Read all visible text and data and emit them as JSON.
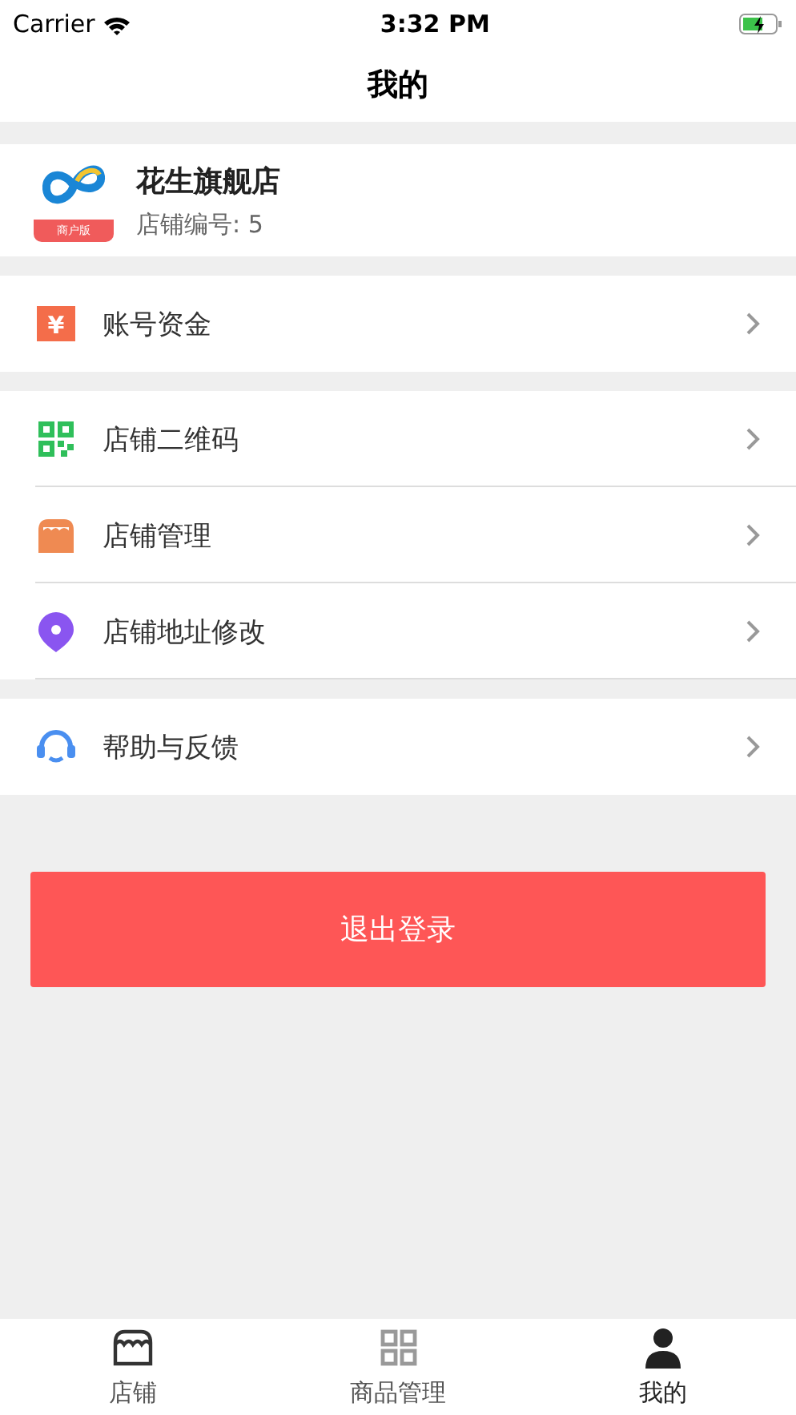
{
  "status_bar": {
    "carrier": "Carrier",
    "time": "3:32 PM"
  },
  "nav": {
    "title": "我的"
  },
  "shop": {
    "logo_badge": "商户版",
    "name": "花生旗舰店",
    "number": "店铺编号: 5"
  },
  "menu_groups": [
    {
      "items": [
        {
          "kind": "money",
          "label": "账号资金",
          "glyph": "¥"
        }
      ]
    },
    {
      "items": [
        {
          "kind": "qrcode",
          "label": "店铺二维码"
        },
        {
          "kind": "store",
          "label": "店铺管理"
        },
        {
          "kind": "location",
          "label": "店铺地址修改"
        }
      ]
    },
    {
      "items": [
        {
          "kind": "support",
          "label": "帮助与反馈"
        }
      ]
    }
  ],
  "logout_button": "退出登录",
  "tab_bar": [
    {
      "kind": "store",
      "label": "店铺",
      "selected": false
    },
    {
      "kind": "grid",
      "label": "商品管理",
      "selected": false
    },
    {
      "kind": "person",
      "label": "我的",
      "selected": true
    }
  ]
}
